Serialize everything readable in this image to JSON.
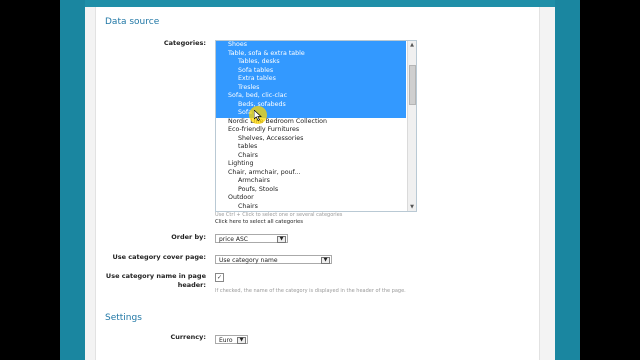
{
  "section_data_source": "Data source",
  "categories": {
    "label": "Categories:",
    "items": [
      {
        "text": "Shoes",
        "level": 1,
        "selected": true
      },
      {
        "text": "Table, sofa & extra table",
        "level": 1,
        "selected": true
      },
      {
        "text": "Tables, desks",
        "level": 2,
        "selected": true
      },
      {
        "text": "Sofa tables",
        "level": 2,
        "selected": true
      },
      {
        "text": "Extra tables",
        "level": 2,
        "selected": true
      },
      {
        "text": "Tresles",
        "level": 2,
        "selected": true
      },
      {
        "text": "Sofa, bed, clic-clac",
        "level": 1,
        "selected": true
      },
      {
        "text": "Beds, sofabeds",
        "level": 2,
        "selected": true
      },
      {
        "text": "Sofa",
        "level": 2,
        "selected": true
      },
      {
        "text": "Nordic Line Bedroom Collection",
        "level": 1,
        "selected": false
      },
      {
        "text": "Eco-friendly Furnitures",
        "level": 1,
        "selected": false
      },
      {
        "text": "Shelves, Accessories",
        "level": 2,
        "selected": false
      },
      {
        "text": "tables",
        "level": 2,
        "selected": false
      },
      {
        "text": "Chairs",
        "level": 2,
        "selected": false
      },
      {
        "text": "Lighting",
        "level": 1,
        "selected": false
      },
      {
        "text": "Chair, armchair, pouf...",
        "level": 1,
        "selected": false
      },
      {
        "text": "Armchairs",
        "level": 2,
        "selected": false
      },
      {
        "text": "Poufs, Stools",
        "level": 2,
        "selected": false
      },
      {
        "text": "Outdoor",
        "level": 1,
        "selected": false
      },
      {
        "text": "Chairs",
        "level": 2,
        "selected": false
      }
    ],
    "hint": "Use Ctrl + Click to select one or several categories",
    "select_all": "Click here to select all categories"
  },
  "order_by": {
    "label": "Order by:",
    "value": "price ASC"
  },
  "cover_page": {
    "label": "Use category cover page:",
    "value": "Use category name"
  },
  "name_in_header": {
    "label_line1": "Use category name in page",
    "label_line2": "header:",
    "checked": true,
    "check_glyph": "✓",
    "hint": "If checked, the name of the category is displayed in the header of the page."
  },
  "section_settings": "Settings",
  "currency": {
    "label": "Currency:",
    "value": "Euro"
  },
  "icons": {
    "dropdown": "▼",
    "scroll_up": "▲",
    "scroll_down": "▼"
  },
  "colors": {
    "accent": "#2278a6",
    "selection": "#3399ff",
    "frame": "#1f8fa8"
  }
}
